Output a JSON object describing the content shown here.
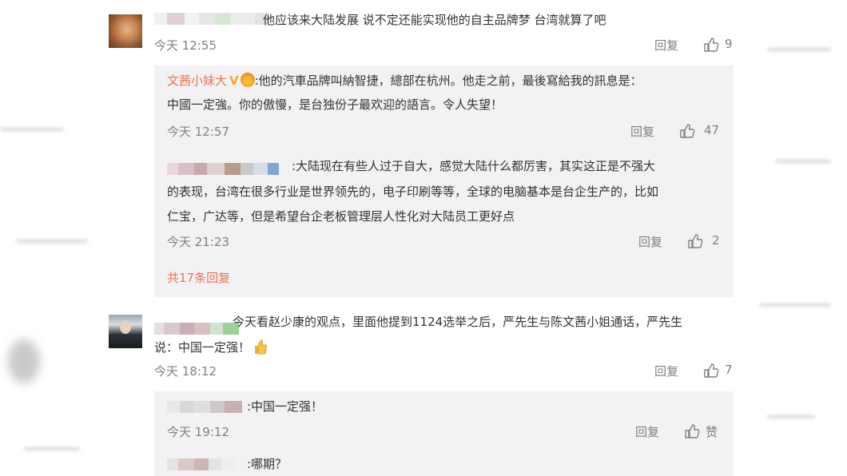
{
  "comments": [
    {
      "text": "他应该来大陆发展 说不定还能实现他的自主品牌梦 台湾就算了吧",
      "time": "今天 12:55",
      "reply_label": "回复",
      "likes": "9",
      "replies": [
        {
          "author": "文茜小妹大",
          "line1": ":他的汽車品牌叫納智捷，總部在杭州。他走之前，最後寫給我的訊息是：",
          "line2": "中國一定強。你的傲慢，是台独份子最欢迎的語言。令人失望！",
          "time": "今天 12:57",
          "reply_label": "回复",
          "likes": "47"
        },
        {
          "line1": ":大陆现在有些人过于自大，感觉大陆什么都厉害，其实这正是不强大",
          "line2": "的表现，台湾在很多行业是世界领先的，电子印刷等等，全球的电脑基本是台企生产的，比如",
          "line3": "仁宝，广达等，但是希望台企老板管理层人性化对大陆员工更好点",
          "time": "今天 21:23",
          "reply_label": "回复",
          "likes": "2"
        }
      ],
      "more_replies": "共17条回复"
    },
    {
      "line1": "今天看赵少康的观点，里面他提到1124选举之后，严先生与陈文茜小姐通话，严先生",
      "line2": "说：中国一定强！",
      "time": "今天 18:12",
      "reply_label": "回复",
      "likes": "7",
      "replies": [
        {
          "text": ":中国一定强！",
          "time": "今天 19:12",
          "reply_label": "回复",
          "like_label": "赞"
        },
        {
          "text": ":哪期？"
        }
      ]
    }
  ],
  "colors": {
    "link": "#eb7350",
    "meta": "#808080",
    "reply_bg": "#f2f2f5"
  }
}
